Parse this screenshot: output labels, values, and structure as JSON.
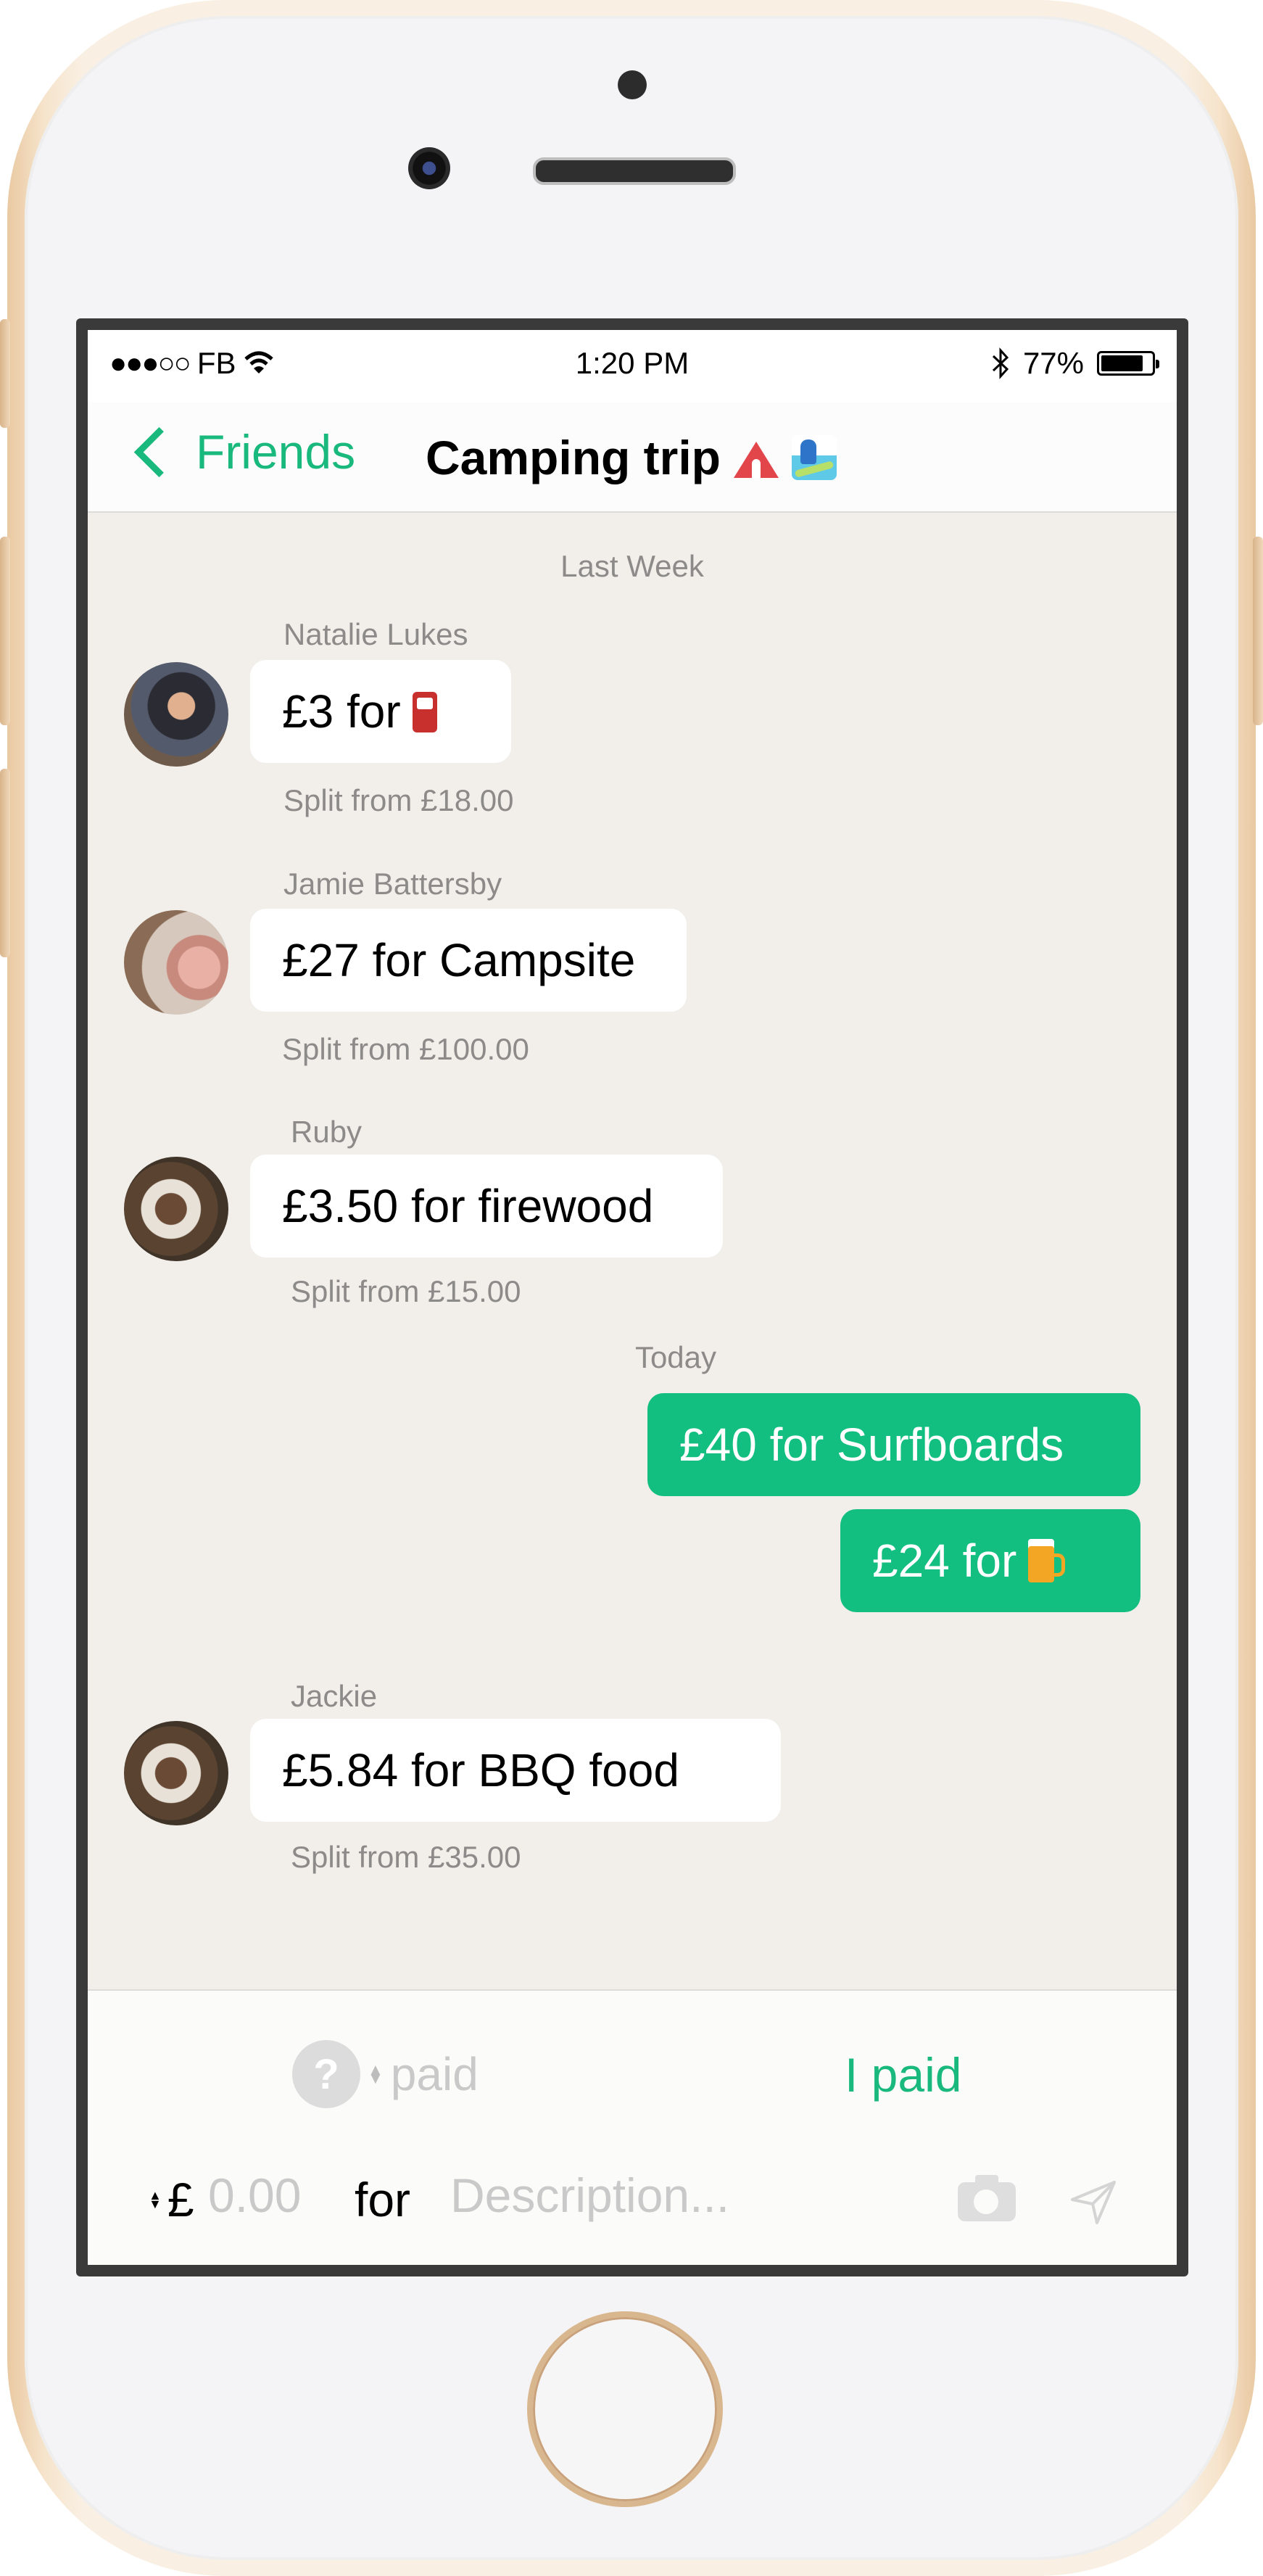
{
  "status_bar": {
    "signal": "●●●○○",
    "carrier": "FB",
    "time": "1:20 PM",
    "battery": "77%",
    "battery_level": 0.77
  },
  "nav": {
    "back_label": "Friends",
    "title": "Camping trip"
  },
  "chat": {
    "separator_last_week": "Last Week",
    "separator_today": "Today",
    "messages": [
      {
        "sender": "Natalie Lukes",
        "text": "£3 for",
        "emoji_icon": "fuel-pump-icon",
        "note": "Split from £18.00"
      },
      {
        "sender": "Jamie Battersby",
        "text": "£27 for Campsite",
        "note": "Split from £100.00"
      },
      {
        "sender": "Ruby",
        "text": "£3.50 for firewood",
        "note": "Split from £15.00"
      },
      {
        "sender": "",
        "text": "£40 for Surfboards",
        "mine": true
      },
      {
        "sender": "",
        "text": "£24 for",
        "emoji_icon": "beer-mug-icon",
        "mine": true
      },
      {
        "sender": "Jackie",
        "text": "£5.84 for BBQ food",
        "note": "Split from £35.00"
      }
    ]
  },
  "composer": {
    "payer_unknown_symbol": "?",
    "payer_label": "paid",
    "i_paid_label": "I paid",
    "currency_symbol": "£",
    "amount_placeholder": "0.00",
    "for_label": "for",
    "description_placeholder": "Description..."
  },
  "colors": {
    "accent": "#19b97e",
    "mine_bubble": "#13bf80",
    "chat_background": "#f2efeb"
  }
}
